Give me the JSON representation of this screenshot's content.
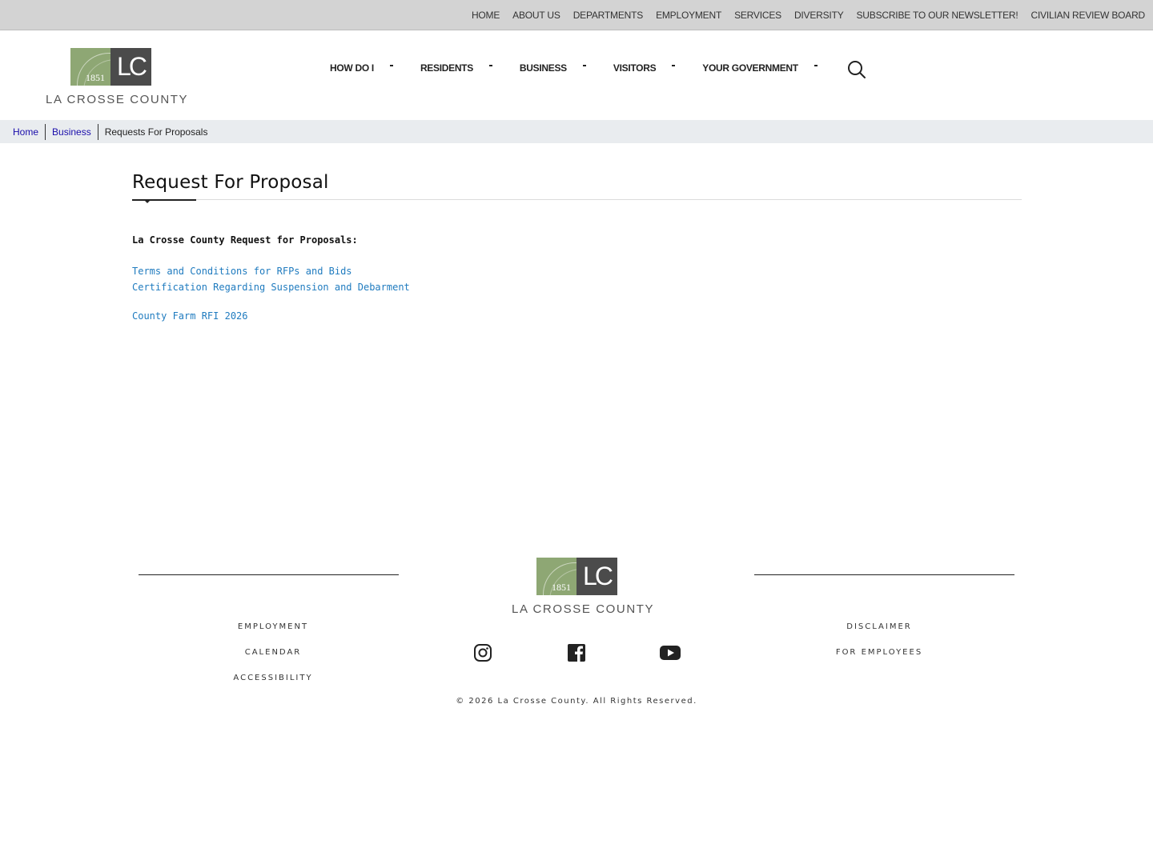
{
  "utility_nav": {
    "items": [
      {
        "label": "HOME"
      },
      {
        "label": "ABOUT US"
      },
      {
        "label": "DEPARTMENTS"
      },
      {
        "label": "EMPLOYMENT"
      },
      {
        "label": "SERVICES"
      },
      {
        "label": "DIVERSITY"
      },
      {
        "label": "SUBSCRIBE TO OUR NEWSLETTER!"
      },
      {
        "label": "CIVILIAN REVIEW BOARD"
      }
    ]
  },
  "logo": {
    "initials": "LC",
    "year": "1851",
    "name": "LA CROSSE COUNTY"
  },
  "main_nav": {
    "items": [
      {
        "label": "HOW DO I"
      },
      {
        "label": "RESIDENTS"
      },
      {
        "label": "BUSINESS"
      },
      {
        "label": "VISITORS"
      },
      {
        "label": "YOUR GOVERNMENT"
      }
    ],
    "search_icon": "search-icon"
  },
  "breadcrumb": {
    "items": [
      {
        "label": "Home"
      },
      {
        "label": "Business"
      },
      {
        "label": "Requests For Proposals"
      }
    ]
  },
  "content": {
    "title": "Request For Proposal",
    "heading": "La Crosse County Request for Proposals:",
    "links_group1": [
      {
        "label": "Terms and Conditions for RFPs and Bids"
      },
      {
        "label": "Certification Regarding Suspension and Debarment"
      }
    ],
    "links_group2": [
      {
        "label": "County Farm RFI 2026"
      }
    ]
  },
  "footer": {
    "left_links": [
      {
        "label": "EMPLOYMENT"
      },
      {
        "label": "CALENDAR"
      },
      {
        "label": "ACCESSIBILITY"
      }
    ],
    "right_links": [
      {
        "label": "DISCLAIMER"
      },
      {
        "label": "FOR EMPLOYEES"
      }
    ],
    "social": [
      {
        "icon": "instagram-icon"
      },
      {
        "icon": "facebook-icon"
      },
      {
        "icon": "youtube-icon"
      }
    ],
    "copyright": "© 2026 La Crosse County. All Rights Reserved."
  },
  "colors": {
    "utility_bar": "#d3d3d3",
    "logo_green": "#8ea774",
    "logo_dark": "#4b4b4b",
    "link": "#1f7bbf",
    "breadcrumb_bg": "#e9ecef"
  }
}
